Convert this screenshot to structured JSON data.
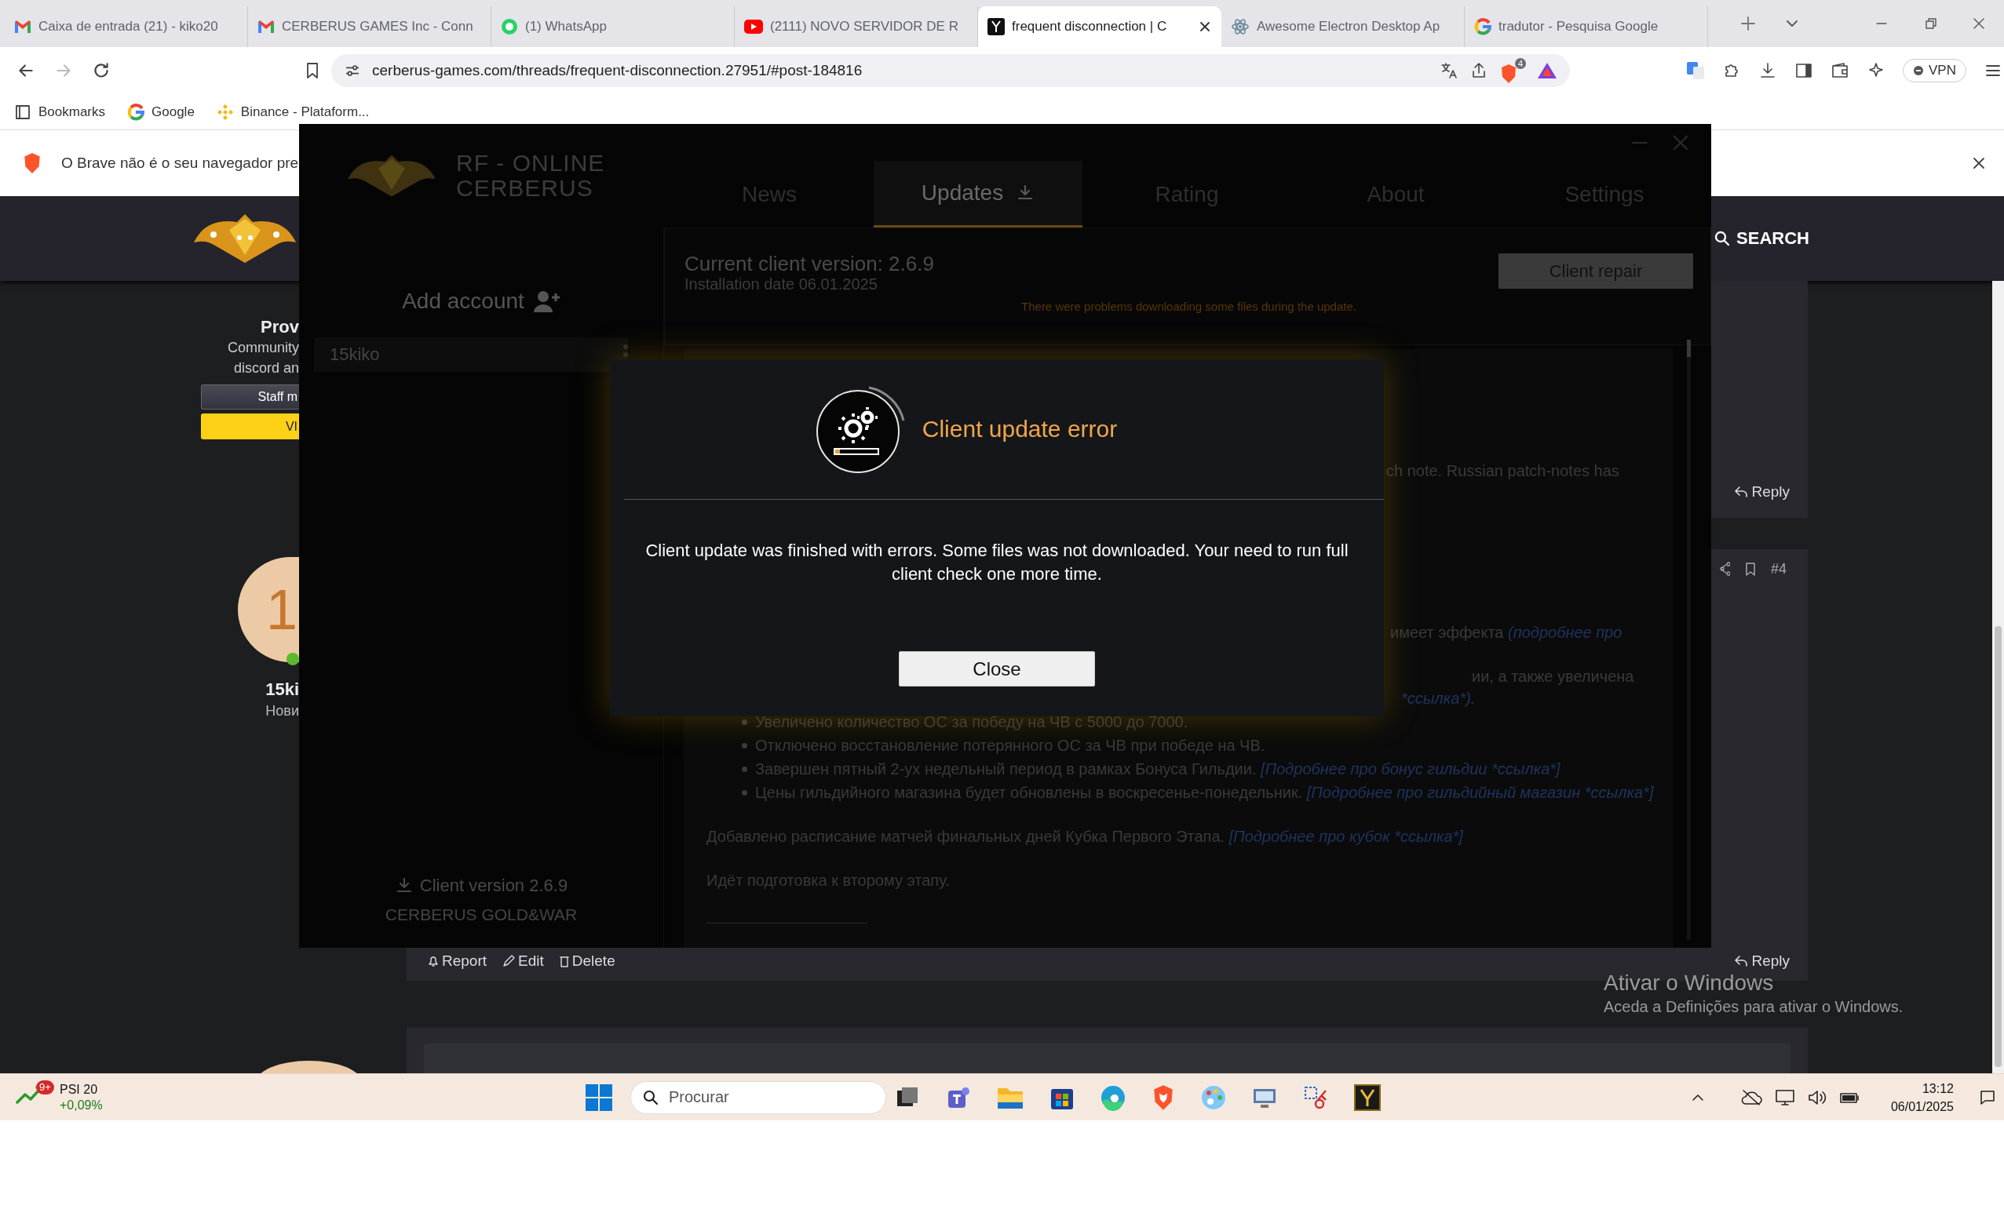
{
  "browser": {
    "tabs": [
      {
        "title": "Caixa de entrada (21) - kiko20",
        "kind": "gmail",
        "selected": false
      },
      {
        "title": "CERBERUS GAMES Inc - Conn",
        "kind": "gmail",
        "selected": false
      },
      {
        "title": "(1) WhatsApp",
        "kind": "whatsapp",
        "selected": false
      },
      {
        "title": "(2111) NOVO SERVIDOR DE R",
        "kind": "youtube",
        "selected": false
      },
      {
        "title": "frequent disconnection | C",
        "kind": "forum",
        "selected": true
      },
      {
        "title": "Awesome Electron Desktop Ap",
        "kind": "electron",
        "selected": false
      },
      {
        "title": "tradutor - Pesquisa Google",
        "kind": "google",
        "selected": false
      }
    ],
    "address": "cerberus-games.com/threads/frequent-disconnection.27951/#post-184816",
    "shield_count": "4",
    "vpn": "VPN",
    "bookmarks": [
      {
        "label": "Bookmarks",
        "kind": "folder"
      },
      {
        "label": "Google",
        "kind": "google"
      },
      {
        "label": "Binance - Plataform...",
        "kind": "binance"
      }
    ],
    "notice": "O Brave não é o seu navegador pre"
  },
  "site": {
    "search": "SEARCH",
    "profile": {
      "name": "Prov",
      "title_lines": [
        "Community",
        "discord an"
      ],
      "badges": [
        {
          "label": "Staff m",
          "kind": "staff"
        },
        {
          "label": "VI",
          "kind": "vip"
        }
      ]
    },
    "poster": {
      "initial": "1",
      "name": "15ki",
      "rank": "Нови"
    },
    "posts": [
      {
        "reply": "Reply"
      },
      {
        "number": "#4",
        "actions": [
          "Report",
          "Edit",
          "Delete"
        ],
        "reply": "Reply"
      }
    ]
  },
  "launcher": {
    "logo_lines": [
      "RF - ONLINE",
      "CERBERUS"
    ],
    "tabs": [
      {
        "label": "News",
        "kind": "plain",
        "selected": false
      },
      {
        "label": "Updates",
        "kind": "download",
        "selected": true
      },
      {
        "label": "Rating",
        "kind": "plain",
        "selected": false
      },
      {
        "label": "About",
        "kind": "plain",
        "selected": false
      },
      {
        "label": "Settings",
        "kind": "plain",
        "selected": false
      }
    ],
    "add_account": "Add account",
    "accounts": [
      {
        "name": "15kiko"
      }
    ],
    "client_version": "Client version 2.6.9",
    "server": "CERBERUS GOLD&WAR",
    "current_version": "Current client version: 2.6.9",
    "install_date": "Installation date 06.01.2025",
    "repair": "Client repair",
    "warning": "There were problems downloading some files during the update.",
    "notes": [
      {
        "kind": "fragment",
        "text": "ch note. Russian patch-notes has"
      },
      {
        "kind": "fragment",
        "text": "имеет эффекта ",
        "link": "(подробнее про"
      },
      {
        "kind": "fragment",
        "text": "ии, а также увеличена"
      },
      {
        "kind": "fragment",
        "link": "*ссылка*)."
      },
      {
        "kind": "bullet",
        "text": "Увеличено количество ОС за победу на ЧВ с 5000 до 7000."
      },
      {
        "kind": "bullet",
        "text": "Отключено восстановление потерянного ОС за ЧВ при победе на ЧВ."
      },
      {
        "kind": "bullet",
        "text": "Завершен пятный 2-ух недельный период в рамках Бонуса Гильдии. ",
        "link": "[Подробнее про бонус гильдии *ссылка*]"
      },
      {
        "kind": "bullet",
        "text": "Цены гильдийного магазина будет обновлены в воскресенье-понедельник. ",
        "link": "[Подробнее про гильдийный магазин *ссылка*]"
      },
      {
        "kind": "paragraph",
        "text": "Добавлено расписание матчей финальных дней Кубка Первого Этапа. ",
        "link": "[Подробнее про кубок *ссылка*]"
      },
      {
        "kind": "paragraph",
        "text": "Идёт подготовка к второму этапу."
      }
    ],
    "modal": {
      "title": "Client update error",
      "message": "Client update was finished with errors. Some files was not downloaded. Your need to run full client check one more time.",
      "button": "Close"
    }
  },
  "windows_activation": {
    "title": "Ativar o Windows",
    "text": "Aceda a Definições para ativar o Windows."
  },
  "taskbar": {
    "widget": {
      "badge": "9+",
      "title": "PSI 20",
      "change": "+0,09%"
    },
    "search_placeholder": "Procurar",
    "time": "13:12",
    "date": "06/01/2025"
  }
}
